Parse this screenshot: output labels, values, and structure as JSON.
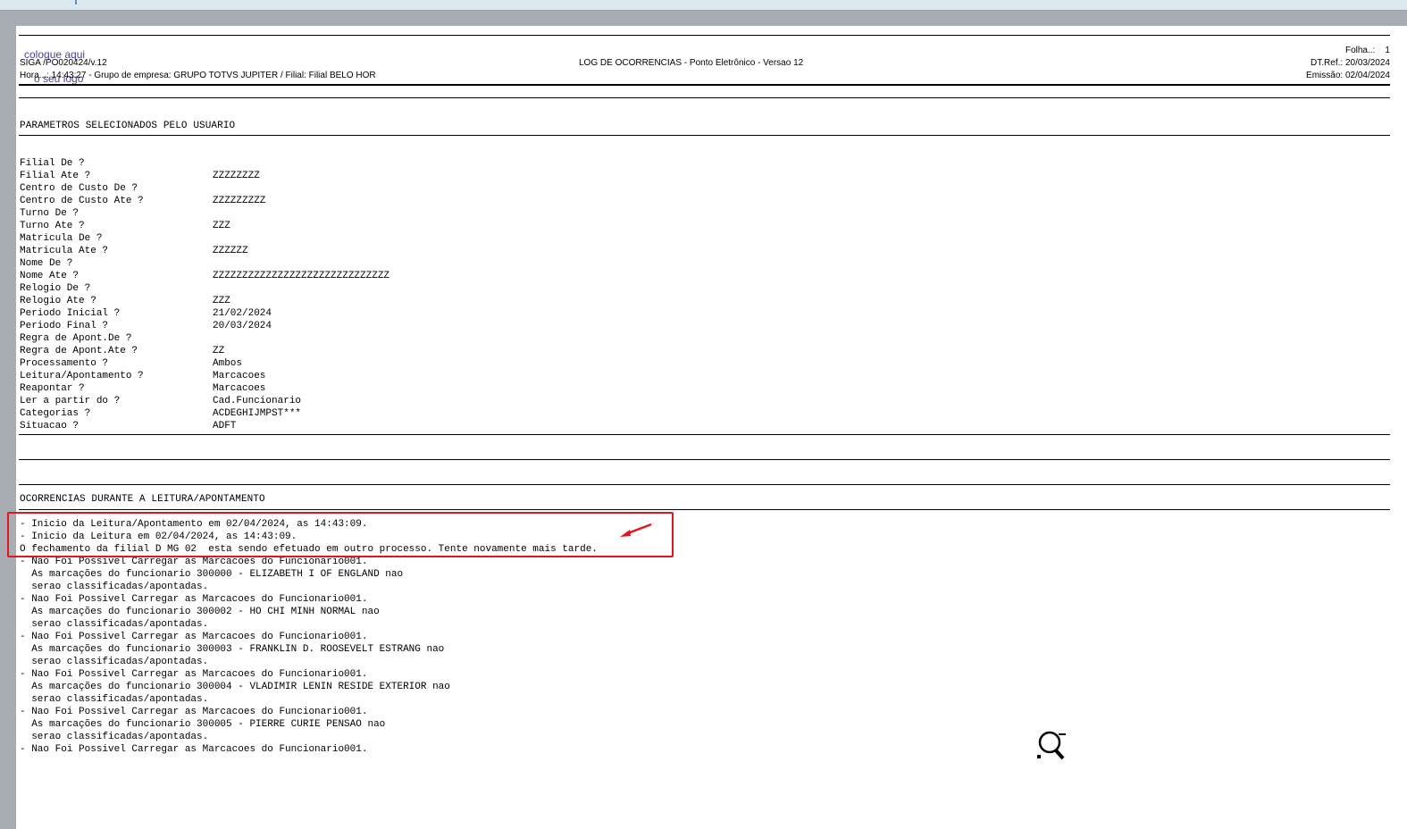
{
  "header": {
    "logo_line1": "coloque aqui",
    "logo_line2": "o seu logo",
    "folha": "Folha..:    1",
    "program": "SIGA /PO020424/v.12",
    "title": "LOG DE OCORRENCIAS - Ponto Eletrônico - Versao 12",
    "dtref": "DT.Ref.: 20/03/2024",
    "hora": "Hora...: 14:43:27 - Grupo de empresa: GRUPO TOTVS JUPITER / Filial: Filial BELO HOR",
    "emissao": "Emissão: 02/04/2024"
  },
  "params": {
    "section_title": "PARAMETROS SELECIONADOS PELO USUARIO",
    "rows": [
      {
        "label": "Filial De ?",
        "value": ""
      },
      {
        "label": "Filial Ate ?",
        "value": "ZZZZZZZZ"
      },
      {
        "label": "Centro de Custo De ?",
        "value": ""
      },
      {
        "label": "Centro de Custo Ate ?",
        "value": "ZZZZZZZZZ"
      },
      {
        "label": "Turno De ?",
        "value": ""
      },
      {
        "label": "Turno Ate ?",
        "value": "ZZZ"
      },
      {
        "label": "Matricula De ?",
        "value": ""
      },
      {
        "label": "Matricula Ate ?",
        "value": "ZZZZZZ"
      },
      {
        "label": "Nome De ?",
        "value": ""
      },
      {
        "label": "Nome Ate ?",
        "value": "ZZZZZZZZZZZZZZZZZZZZZZZZZZZZZZ"
      },
      {
        "label": "Relogio De ?",
        "value": ""
      },
      {
        "label": "Relogio Ate ?",
        "value": "ZZZ"
      },
      {
        "label": "Periodo Inicial ?",
        "value": "21/02/2024"
      },
      {
        "label": "Periodo Final ?",
        "value": "20/03/2024"
      },
      {
        "label": "Regra de Apont.De ?",
        "value": ""
      },
      {
        "label": "Regra de Apont.Ate ?",
        "value": "ZZ"
      },
      {
        "label": "Processamento ?",
        "value": "Ambos"
      },
      {
        "label": "Leitura/Apontamento ?",
        "value": "Marcacoes"
      },
      {
        "label": "Reapontar ?",
        "value": "Marcacoes"
      },
      {
        "label": "Ler a partir do ?",
        "value": "Cad.Funcionario"
      },
      {
        "label": "Categorias ?",
        "value": "ACDEGHIJMPST***"
      },
      {
        "label": "Situacao ?",
        "value": "ADFT"
      }
    ]
  },
  "ocorrencias": {
    "section_title": "OCORRENCIAS DURANTE A LEITURA/APONTAMENTO",
    "lines": [
      "- Inicio da Leitura/Apontamento em 02/04/2024, as 14:43:09.",
      "- Inicio da Leitura em 02/04/2024, as 14:43:09.",
      "O fechamento da filial D MG 02  esta sendo efetuado em outro processo. Tente novamente mais tarde.",
      "- Nao Foi Possivel Carregar as Marcacoes do Funcionario001.",
      "  As marcações do funcionario 300000 - ELIZABETH I OF ENGLAND nao",
      "  serao classificadas/apontadas.",
      "- Nao Foi Possivel Carregar as Marcacoes do Funcionario001.",
      "  As marcações do funcionario 300002 - HO CHI MINH NORMAL nao",
      "  serao classificadas/apontadas.",
      "- Nao Foi Possivel Carregar as Marcacoes do Funcionario001.",
      "  As marcações do funcionario 300003 - FRANKLIN D. ROOSEVELT ESTRANG nao",
      "  serao classificadas/apontadas.",
      "- Nao Foi Possivel Carregar as Marcacoes do Funcionario001.",
      "  As marcações do funcionario 300004 - VLADIMIR LENIN RESIDE EXTERIOR nao",
      "  serao classificadas/apontadas.",
      "- Nao Foi Possivel Carregar as Marcacoes do Funcionario001.",
      "  As marcações do funcionario 300005 - PIERRE CURIE PENSAO nao",
      "  serao classificadas/apontadas.",
      "- Nao Foi Possivel Carregar as Marcacoes do Funcionario001."
    ]
  },
  "colors": {
    "highlight": "#e8141b",
    "logo": "#4d3f9a"
  },
  "icons": {
    "annotation_arrow": "red-arrow-icon",
    "cursor": "zoom-cursor-icon"
  }
}
